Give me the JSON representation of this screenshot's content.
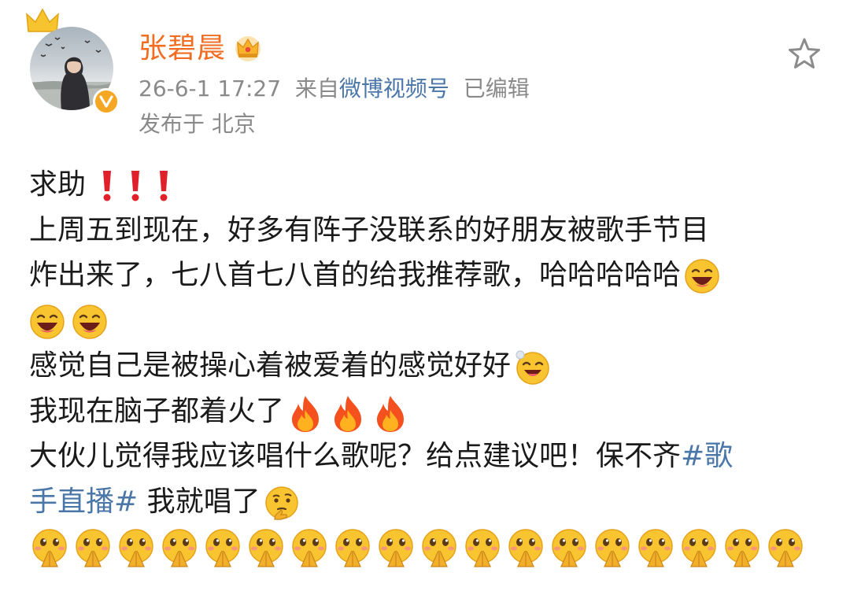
{
  "author": {
    "name": "张碧晨",
    "vip_icon": "crown-icon",
    "verified_icon": "verified-v-icon"
  },
  "meta": {
    "time": "26-6-1 17:27",
    "from_prefix": "来自",
    "source": "微博视频号",
    "edited": "已编辑",
    "location_prefix": "发布于",
    "location": "北京"
  },
  "actions": {
    "favorite_icon": "star-outline-icon"
  },
  "post": {
    "line1": "求助",
    "line2": "上周五到现在，好多有阵子没联系的好朋友被歌手节目",
    "line3": "炸出来了，七八首七八首的给我推荐歌，哈哈哈哈哈",
    "line5": "感觉自己是被操心着被爱着的感觉好好",
    "line6": "我现在脑子都着火了",
    "line7a": "大伙儿觉得我应该唱什么歌呢？给点建议吧！保不齐",
    "line7b": "#歌",
    "line8a": "手直播#",
    "line8b": " 我就唱了",
    "emoji_laugh": "laughing-face-icon",
    "emoji_fire": "fire-icon",
    "emoji_pray_count": 18
  },
  "colors": {
    "username": "#f06d21",
    "link": "#4a76a8",
    "meta": "#8a8a8a",
    "exclamation": "#e0202a"
  }
}
